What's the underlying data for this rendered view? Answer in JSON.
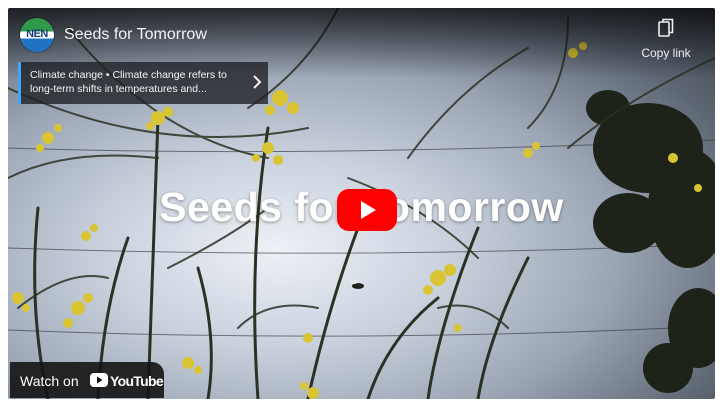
{
  "video": {
    "channel_logo_text": "NEN",
    "title": "Seeds for Tomorrow",
    "overlay_title": "Seeds for Tomorrow"
  },
  "copy_link": {
    "label": "Copy link",
    "icon": "copy-icon"
  },
  "info_card": {
    "text": "Climate change • Climate change refers to long-term shifts in temperatures and...",
    "icon": "chevron-right-icon"
  },
  "watch_bar": {
    "label": "Watch on",
    "brand": "YouTube",
    "icon": "youtube-logo-icon"
  },
  "colors": {
    "play_red": "#ff0000",
    "card_accent": "#3ea6ff",
    "flower_yellow": "#d9c533"
  }
}
